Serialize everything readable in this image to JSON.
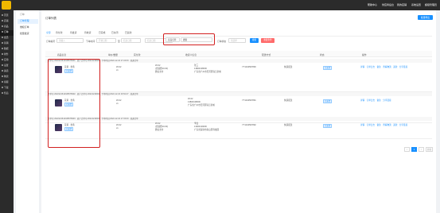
{
  "topbar": {
    "nav": [
      "帮助中心",
      "供应商后台",
      "我的店铺",
      "系统设置"
    ],
    "user": "超级管理员"
  },
  "sidebar": {
    "items": [
      "首页",
      "店铺",
      "商品",
      "订单",
      "会员",
      "营销",
      "数据",
      "财务",
      "应用",
      "设置",
      "渠道",
      "物流",
      "客服",
      "下载",
      "售后"
    ]
  },
  "subnav": {
    "items": [
      "订单",
      "订单管理",
      "维权订单",
      "批量发货"
    ]
  },
  "page": {
    "title": "订单列表",
    "export_label": "批量导出"
  },
  "tabs": [
    "全部",
    "待付款",
    "待发货",
    "待收货",
    "已完成",
    "已关闭",
    "已退款"
  ],
  "filters": {
    "order_no_label": "订单编号",
    "order_no_placeholder": "请输入",
    "time_label": "下单时间",
    "time_sep": "至",
    "time_start": "开始日期",
    "time_end": "结束日期",
    "type_label": "商品名称",
    "type_value": "搜索",
    "status_label": "订单状态",
    "status_value": "请选择",
    "search_label": "搜索",
    "reset_label": "重置条件"
  },
  "table": {
    "headers": [
      "商品信息",
      "单价/数量",
      "实付款",
      "收货人信息",
      "配送方式",
      "状态",
      "操作",
      "售后"
    ],
    "orders": [
      {
        "meta": "订单号:2022121612345678901 · 商户订单号:20221216001 · 下单时间:2022-12-16 17:24:09 · 普通订单",
        "product": "花黄 · 金黄",
        "tag": "已发货",
        "price": "¥0.02",
        "qty": "x1",
        "paid": "¥0.02",
        "paid_note1": "(含运费¥0.00)",
        "paid_note2": "微信支付",
        "receiver": "张三",
        "receiver_phone": "13800138000",
        "receiver_addr": "广东省广州市天河区珠江新城",
        "express_no": "YT1234567890",
        "delivery": "快递配送",
        "status": "已发货",
        "actions": [
          "详情",
          "订单日志",
          "备注",
          "查看物流",
          "退款",
          "分享链接"
        ]
      },
      {
        "meta": "订单号:2022121612345678902 · 商户订单号:20221216002 · 下单时间:2022-12-16 16:52:47 · 普通订单",
        "product": "花黄 · 金黄",
        "tag": "已发货",
        "price": "¥0.02",
        "qty": "x1",
        "paid": "¥0.02",
        "paid_note1": "13800138000",
        "paid_note2": "广东省广州市天河区珠江新城",
        "receiver": "",
        "receiver_phone": "",
        "receiver_addr": "",
        "express_no": "YT1234567891",
        "delivery": "快递配送",
        "status": "已发货",
        "actions": [
          "详情",
          "订单日志",
          "备注",
          "分享链接"
        ]
      },
      {
        "meta": "订单号:2022121612345678903 · 商户订单号:20221216003 · 下单时间:2022-12-16 17:15:09 · 普通订单",
        "product": "花黄 · 金黄",
        "tag": "已发货",
        "price": "¥0.02",
        "qty": "x1",
        "paid": "¥0.02",
        "paid_note1": "(含运费¥0.00)",
        "paid_note2": "微信支付",
        "receiver": "李四",
        "receiver_phone": "13900139000",
        "receiver_addr": "广东省深圳市南山区科技园",
        "express_no": "YT1234567892",
        "delivery": "快递配送",
        "status": "已发货",
        "actions": [
          "详情",
          "订单日志",
          "备注",
          "查看物流",
          "退款",
          "分享链接"
        ]
      }
    ]
  },
  "pagination": {
    "prev": "<",
    "current": "1",
    "next": ">",
    "jump": "前往"
  },
  "colors": {
    "accent": "#1890ff",
    "highlight_border": "#d21f1f",
    "sidebar_bg": "#2b2b2b"
  }
}
